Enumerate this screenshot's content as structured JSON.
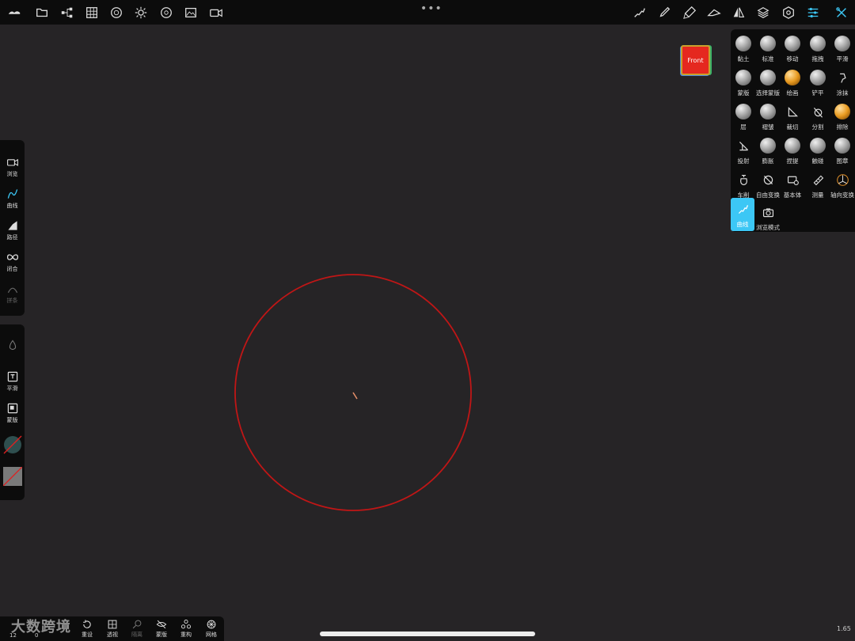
{
  "topbar": {
    "left_icons": [
      "logo-icon",
      "folder-icon",
      "scene-tree-icon",
      "grid-icon",
      "material-sphere-icon",
      "light-sun-icon",
      "aperture-icon",
      "image-icon",
      "video-camera-icon"
    ],
    "right_icons": [
      "stroke-icon",
      "brush-icon",
      "paint-icon",
      "lasso-icon",
      "symmetry-icon",
      "layers-icon",
      "settings-gear-icon",
      "sliders-icon",
      "tools-icon"
    ],
    "menu_dots": "•••"
  },
  "view_cube": {
    "label": "Front"
  },
  "tools": {
    "items": [
      {
        "label": "黏土",
        "icon": "clay-sphere-icon"
      },
      {
        "label": "标准",
        "icon": "standard-sphere-icon"
      },
      {
        "label": "移动",
        "icon": "move-sphere-icon"
      },
      {
        "label": "拖拽",
        "icon": "drag-sphere-icon"
      },
      {
        "label": "平滑",
        "icon": "smooth-sphere-icon"
      },
      {
        "label": "蒙版",
        "icon": "mask-sphere-icon"
      },
      {
        "label": "选择蒙版",
        "icon": "select-mask-sphere-icon"
      },
      {
        "label": "绘画",
        "icon": "paint-sphere-icon"
      },
      {
        "label": "铲平",
        "icon": "flatten-sphere-icon"
      },
      {
        "label": "涂抹",
        "icon": "smudge-icon"
      },
      {
        "label": "层",
        "icon": "layer-sphere-icon"
      },
      {
        "label": "褶皱",
        "icon": "crease-sphere-icon"
      },
      {
        "label": "裁切",
        "icon": "trim-icon"
      },
      {
        "label": "分割",
        "icon": "split-icon"
      },
      {
        "label": "排除",
        "icon": "exclude-sphere-icon"
      },
      {
        "label": "投射",
        "icon": "project-icon"
      },
      {
        "label": "膨胀",
        "icon": "inflate-sphere-icon"
      },
      {
        "label": "捏提",
        "icon": "pinch-sphere-icon"
      },
      {
        "label": "触碰",
        "icon": "tube-sphere-icon"
      },
      {
        "label": "图章",
        "icon": "stamp-sphere-icon"
      },
      {
        "label": "车削",
        "icon": "lathe-icon"
      },
      {
        "label": "自由变换",
        "icon": "free-transform-icon"
      },
      {
        "label": "基本体",
        "icon": "primitive-icon"
      },
      {
        "label": "测量",
        "icon": "measure-ruler-icon"
      },
      {
        "label": "轴向变换",
        "icon": "gizmo-icon"
      }
    ],
    "active_label": "曲线",
    "view_mode_label": "浏览模式"
  },
  "left_panel_a": [
    {
      "label": "浏览",
      "icon": "camera-icon"
    },
    {
      "label": "曲线",
      "icon": "curve-icon"
    },
    {
      "label": "路径",
      "icon": "path-icon"
    },
    {
      "label": "闭合",
      "icon": "infinity-icon"
    },
    {
      "label": "拼条",
      "icon": "spline-icon"
    }
  ],
  "left_panel_b": [
    {
      "label": "平滑",
      "icon": "smooth-box-icon"
    },
    {
      "label": "蒙版",
      "icon": "mask-box-icon"
    }
  ],
  "bottombar": {
    "counter_top": "12",
    "counter_bottom": "0",
    "items": [
      {
        "label": "重设",
        "icon": "reset-icon"
      },
      {
        "label": "透视",
        "icon": "perspective-grid-icon"
      },
      {
        "label": "隔离",
        "icon": "isolate-search-icon"
      },
      {
        "label": "蒙版",
        "icon": "hidden-eye-icon"
      },
      {
        "label": "重构",
        "icon": "remesh-icon"
      },
      {
        "label": "网格",
        "icon": "mesh-icon"
      }
    ]
  },
  "watermark": "大数跨境",
  "version": "1.65",
  "colors": {
    "background": "#262426",
    "bar": "#0c0c0c",
    "accent": "#3cc7f5",
    "circle": "#c01616"
  }
}
